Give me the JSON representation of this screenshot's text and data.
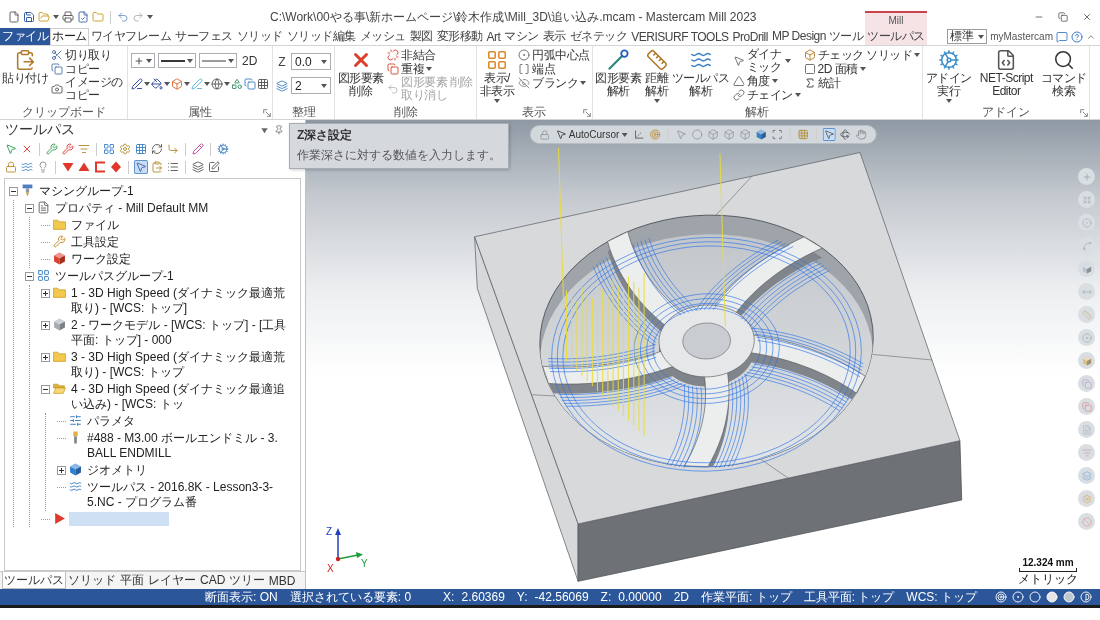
{
  "title_bar": {
    "title": "C:\\Work\\00やる事\\新ホームページ\\鈴木作成\\Mill_3D\\追い込み.mcam - Mastercam Mill 2023",
    "context_group": "Mill"
  },
  "ribbon_tabs": [
    {
      "label": "ファイル",
      "kind": "file",
      "selected": false
    },
    {
      "label": "ホーム",
      "kind": "normal",
      "selected": true
    },
    {
      "label": "ワイヤフレーム",
      "kind": "normal",
      "selected": false
    },
    {
      "label": "サーフェス",
      "kind": "normal",
      "selected": false
    },
    {
      "label": "ソリッド",
      "kind": "normal",
      "selected": false
    },
    {
      "label": "ソリッド編集",
      "kind": "normal",
      "selected": false
    },
    {
      "label": "メッシュ",
      "kind": "normal",
      "selected": false
    },
    {
      "label": "製図",
      "kind": "normal",
      "selected": false
    },
    {
      "label": "変形移動",
      "kind": "normal",
      "selected": false
    },
    {
      "label": "Art",
      "kind": "normal",
      "selected": false
    },
    {
      "label": "マシン",
      "kind": "normal",
      "selected": false
    },
    {
      "label": "表示",
      "kind": "normal",
      "selected": false
    },
    {
      "label": "ゼネテック",
      "kind": "normal",
      "selected": false
    },
    {
      "label": "VERISURF TOOLS",
      "kind": "normal",
      "selected": false
    },
    {
      "label": "ProDrill",
      "kind": "normal",
      "selected": false
    },
    {
      "label": "MP Design ツール",
      "kind": "normal",
      "selected": false
    },
    {
      "label": "ツールパス",
      "kind": "context",
      "selected": false
    }
  ],
  "ribbon_options": {
    "style": "標準",
    "account": "myMastercam"
  },
  "ribbon_groups": [
    {
      "kind": "buttons",
      "label": "クリップボード",
      "launcher": false,
      "large": [
        {
          "label": "貼り付け",
          "dropdown": false
        }
      ],
      "columns": [
        [
          {
            "label": "切り取り",
            "dropdown": false,
            "disabled": false
          },
          {
            "label": "コピー",
            "dropdown": false,
            "disabled": false
          },
          {
            "label": "イメージのコピー",
            "dropdown": false,
            "disabled": false
          }
        ]
      ]
    },
    {
      "kind": "attributes",
      "label": "属性",
      "launcher": true,
      "mode": "2D"
    },
    {
      "kind": "organize",
      "label": "整理",
      "launcher": false,
      "z_label": "Z",
      "z_depth": "0.0",
      "level": "2",
      "tooltip": {
        "title": "Z深さ設定",
        "text": "作業深さに対する数値を入力します。"
      }
    },
    {
      "kind": "buttons",
      "label": "削除",
      "launcher": false,
      "large": [
        {
          "label": "図形要素削除",
          "dropdown": false
        }
      ],
      "columns": [
        [
          {
            "label": "非結合",
            "dropdown": false,
            "disabled": false
          },
          {
            "label": "重複",
            "dropdown": true,
            "disabled": false
          },
          {
            "label": "図形要素 削除取り消し",
            "dropdown": false,
            "disabled": true
          }
        ]
      ]
    },
    {
      "kind": "buttons",
      "label": "表示",
      "launcher": true,
      "large": [
        {
          "label": "表示/非表示",
          "dropdown": true
        }
      ],
      "columns": [
        [
          {
            "label": "円弧中心点",
            "dropdown": false,
            "disabled": false
          },
          {
            "label": "端点",
            "dropdown": false,
            "disabled": false
          },
          {
            "label": "ブランク",
            "dropdown": true,
            "disabled": false
          }
        ]
      ]
    },
    {
      "kind": "buttons",
      "label": "解析",
      "launcher": false,
      "large": [
        {
          "label": "図形要素解析",
          "dropdown": false
        },
        {
          "label": "距離解析",
          "dropdown": true
        },
        {
          "label": "ツールパス解析",
          "dropdown": false
        }
      ],
      "columns": [
        [
          {
            "label": "ダイナミック",
            "dropdown": true,
            "disabled": false
          },
          {
            "label": "角度",
            "dropdown": true,
            "disabled": false
          },
          {
            "label": "チェイン",
            "dropdown": true,
            "disabled": false
          }
        ],
        [
          {
            "label": "チェック ソリッド",
            "dropdown": true,
            "disabled": false
          },
          {
            "label": "2D 面積",
            "dropdown": true,
            "disabled": false
          },
          {
            "label": "統計",
            "dropdown": false,
            "disabled": false
          }
        ]
      ]
    },
    {
      "kind": "buttons",
      "label": "アドイン",
      "launcher": true,
      "large": [
        {
          "label": "アドイン実行",
          "dropdown": true
        },
        {
          "label": "NET-Script Editor",
          "dropdown": false
        },
        {
          "label": "コマンド検索",
          "dropdown": false
        }
      ]
    }
  ],
  "toolpath_panel": {
    "title": "ツールパス",
    "toolbar": [
      [
        {
          "pressed": false
        },
        {
          "pressed": false
        },
        {
          "pressed": false
        },
        {
          "pressed": false
        },
        {
          "pressed": false
        },
        {
          "pressed": false
        },
        {
          "pressed": false
        },
        {
          "pressed": false
        },
        {
          "pressed": false
        },
        {
          "pressed": false
        },
        {
          "pressed": false
        },
        {
          "pressed": false
        }
      ],
      [
        {
          "pressed": false
        },
        {
          "pressed": false
        },
        {
          "pressed": false
        },
        {
          "pressed": false
        },
        {
          "pressed": false
        },
        {
          "pressed": false
        },
        {
          "pressed": false
        },
        {
          "pressed": true
        },
        {
          "pressed": false
        },
        {
          "pressed": false
        },
        {
          "pressed": false
        },
        {
          "pressed": false
        }
      ]
    ],
    "tree": [
      {
        "label": "マシングループ-1",
        "kind": "machine_group",
        "expanded": true,
        "selected": false,
        "children": [
          {
            "label": "プロパティ - Mill Default MM",
            "kind": "properties",
            "expanded": true,
            "selected": false,
            "children": [
              {
                "label": "ファイル",
                "kind": "files",
                "selected": false
              },
              {
                "label": "工具設定",
                "kind": "tool_settings",
                "selected": false
              },
              {
                "label": "ワーク設定",
                "kind": "stock_setup",
                "selected": false
              }
            ]
          },
          {
            "label": "ツールパスグループ-1",
            "kind": "toolpath_group",
            "expanded": true,
            "selected": false,
            "children": [
              {
                "label": "1 - 3D High Speed (ダイナミック最適荒取り) - [WCS: トップ]",
                "kind": "operation",
                "expanded": false,
                "selected": false
              },
              {
                "label": "2 - ワークモデル - [WCS: トップ] - [工具平面: トップ] - 000",
                "kind": "stock_model",
                "expanded": false,
                "selected": false
              },
              {
                "label": "3 - 3D High Speed (ダイナミック最適荒取り) - [WCS: トップ",
                "kind": "operation",
                "expanded": false,
                "selected": false
              },
              {
                "label": "4 - 3D High Speed (ダイナミック最適追い込み) - [WCS: トッ",
                "kind": "operation",
                "expanded": true,
                "selected": false,
                "children": [
                  {
                    "label": "パラメタ",
                    "kind": "parameters",
                    "selected": false
                  },
                  {
                    "label": "#488 - M3.00 ボールエンドミル - 3. BALL ENDMILL",
                    "kind": "tool",
                    "selected": false
                  },
                  {
                    "label": "ジオメトリ",
                    "kind": "geometry",
                    "expanded": false,
                    "selected": false
                  },
                  {
                    "label": "ツールパス - 2016.8K - Lesson3-3-5.NC - プログラム番",
                    "kind": "toolpath",
                    "selected": false
                  }
                ]
              },
              {
                "kind": "insert_arrow",
                "selected": true
              }
            ]
          }
        ]
      }
    ],
    "tabs": [
      {
        "label": "ツールパス",
        "selected": true
      },
      {
        "label": "ソリッド",
        "selected": false
      },
      {
        "label": "平面",
        "selected": false
      },
      {
        "label": "レイヤー",
        "selected": false
      },
      {
        "label": "CAD ツリー",
        "selected": false
      },
      {
        "label": "MBD",
        "selected": false
      }
    ]
  },
  "viewport": {
    "toolbar": {
      "autocursor": "AutoCursor",
      "tools": [
        {
          "pressed": false
        },
        {
          "pressed": false
        },
        {
          "pressed": false
        },
        {
          "pressed": false
        },
        {
          "pressed": false
        },
        {
          "pressed": false
        },
        {
          "pressed": false
        },
        {
          "pressed": false
        },
        {
          "pressed": false
        },
        {
          "pressed": false
        },
        {
          "pressed": true
        },
        {
          "pressed": false
        },
        {
          "pressed": false
        }
      ]
    },
    "axis_labels": [
      "Z",
      "Y",
      "X"
    ],
    "scale": {
      "length": "12.324 mm",
      "units": "メトリック"
    }
  },
  "status_bar": {
    "section_view": "断面表示: ON",
    "selection": "選択されている要素: 0",
    "coordinates": [
      {
        "axis": "X:",
        "value": "2.60369"
      },
      {
        "axis": "Y:",
        "value": "-42.56069"
      },
      {
        "axis": "Z:",
        "value": "0.00000"
      }
    ],
    "mode": "2D",
    "planes": [
      "作業平面: トップ",
      "工具平面: トップ",
      "WCS: トップ"
    ]
  }
}
